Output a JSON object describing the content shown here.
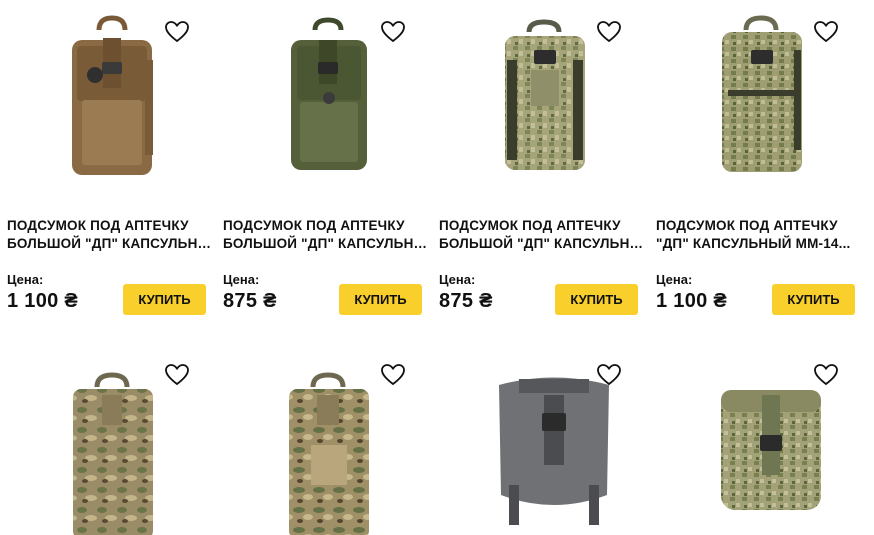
{
  "colors": {
    "accent_button": "#f9cf2b",
    "text": "#111111"
  },
  "products": [
    {
      "title_line1": "ПОДСУМОК ПОД АПТЕЧКУ",
      "title_line2": "БОЛЬШОЙ \"ДП\" КАПСУЛЬНАЯ...",
      "price_label": "Цена:",
      "price": "1 100 ₴",
      "buy_label": "КУПИТЬ",
      "image": "coyote-pouch",
      "fav_icon": "heart-outline-icon"
    },
    {
      "title_line1": "ПОДСУМОК ПОД АПТЕЧКУ",
      "title_line2": "БОЛЬШОЙ \"ДП\" КАПСУЛЬНАЯ...",
      "price_label": "Цена:",
      "price": "875 ₴",
      "buy_label": "КУПИТЬ",
      "image": "olive-pouch",
      "fav_icon": "heart-outline-icon"
    },
    {
      "title_line1": "ПОДСУМОК ПОД АПТЕЧКУ",
      "title_line2": "БОЛЬШОЙ \"ДП\" КАПСУЛЬНАЯ...",
      "price_label": "Цена:",
      "price": "875 ₴",
      "buy_label": "КУПИТЬ",
      "image": "pixel-camo-pouch",
      "fav_icon": "heart-outline-icon"
    },
    {
      "title_line1": "ПОДСУМОК ПОД АПТЕЧКУ",
      "title_line2": "\"ДП\" КАПСУЛЬНЫЙ ММ-14...",
      "price_label": "Цена:",
      "price": "1 100 ₴",
      "buy_label": "КУПИТЬ",
      "image": "pixel-camo-pouch",
      "fav_icon": "heart-outline-icon"
    },
    {
      "image": "multicam-pouch",
      "fav_icon": "heart-outline-icon"
    },
    {
      "image": "multicam-pouch",
      "fav_icon": "heart-outline-icon"
    },
    {
      "image": "grey-dump-pouch",
      "fav_icon": "heart-outline-icon"
    },
    {
      "image": "pixel-camo-box-pouch",
      "fav_icon": "heart-outline-icon"
    }
  ]
}
